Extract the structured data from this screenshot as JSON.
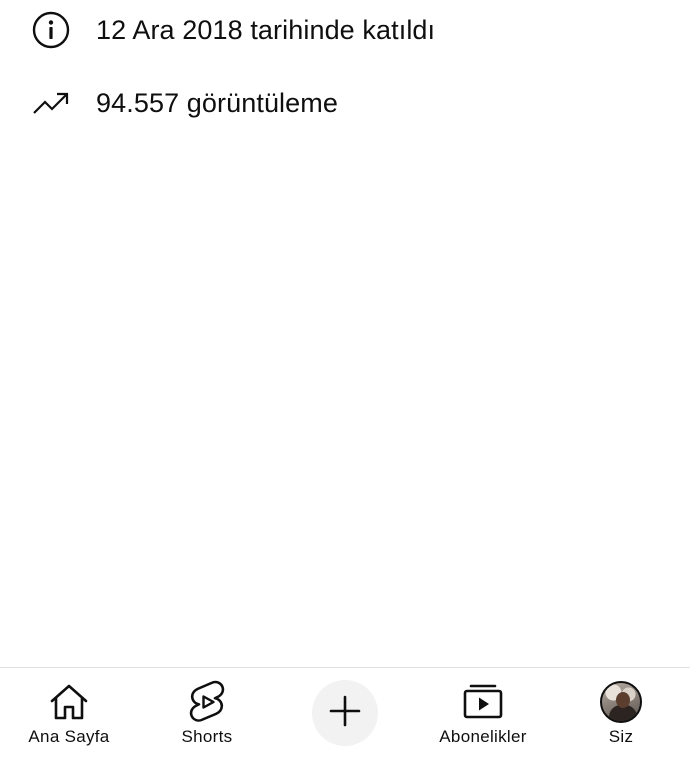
{
  "about": {
    "joined": {
      "icon": "info-icon",
      "text": "12 Ara 2018 tarihinde katıldı"
    },
    "views": {
      "icon": "trending-up-icon",
      "text": "94.557 görüntüleme"
    }
  },
  "bottom_nav": {
    "items": [
      {
        "id": "home",
        "icon": "home-icon",
        "label": "Ana Sayfa"
      },
      {
        "id": "shorts",
        "icon": "shorts-icon",
        "label": "Shorts"
      },
      {
        "id": "create",
        "icon": "plus-icon",
        "label": ""
      },
      {
        "id": "subscriptions",
        "icon": "subscriptions-icon",
        "label": "Abonelikler"
      },
      {
        "id": "you",
        "icon": "avatar",
        "label": "Siz"
      }
    ],
    "colors": {
      "icon": "#0f0f0f",
      "create_bg": "#f2f2f2",
      "divider": "#e0e0e0"
    }
  }
}
